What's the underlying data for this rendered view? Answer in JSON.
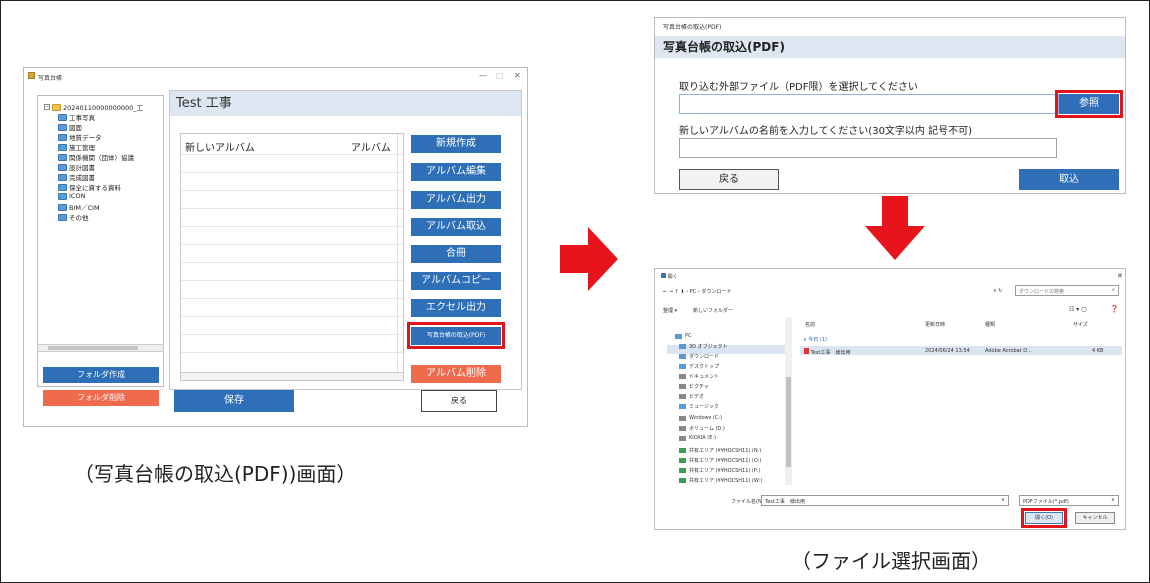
{
  "left_window": {
    "title": "写真台帳",
    "tree": [
      "20240110000000000_工",
      "工事写真",
      "図面",
      "地質データ",
      "施工管理",
      "関係機関（団体）協議",
      "設計図書",
      "完成図書",
      "保全に資する資料",
      "ICON",
      "BIM／CIM",
      "その他"
    ],
    "project_title": "Test 工事",
    "list_headers": {
      "name": "新しいアルバム",
      "album": "アルバム"
    },
    "buttons": {
      "new": "新規作成",
      "edit": "アルバム編集",
      "export": "アルバム出力",
      "import": "アルバム取込",
      "merge": "合冊",
      "copy": "アルバムコピー",
      "excel": "エクセル出力",
      "import_pdf": "写真台帳の取込(PDF)",
      "delete_album": "アルバム削除",
      "save": "保存",
      "back": "戻る",
      "create_folder": "フォルダ作成",
      "delete_folder": "フォルダ削除"
    },
    "caption": "（写真台帳の取込(PDF))画面）"
  },
  "import_dialog": {
    "titlebar": "写真台帳の取込(PDF)",
    "header": "写真台帳の取込(PDF)",
    "file_label": "取り込む外部ファイル（PDF限）を選択してください",
    "file_value": "",
    "browse": "参照",
    "name_label": "新しいアルバムの名前を入力してください(30文字以内 記号不可)",
    "name_value": "",
    "back": "戻る",
    "import": "取込"
  },
  "file_dialog": {
    "title": "開く",
    "path": "← → ↑ ⬇ › PC › ダウンロード",
    "search_placeholder": "ダウンロードの検索",
    "organize": "整理 ▾",
    "new_folder": "新しいフォルダー",
    "nav": [
      "PC",
      "3D オブジェクト",
      "ダウンロード",
      "デスクトップ",
      "ドキュメント",
      "ピクチャ",
      "ビデオ",
      "ミュージック",
      "Windows (C:)",
      "ボリューム (D:)",
      "KIOXIA (E:)",
      "共有エリア (¥¥HOCSH11) (N:)",
      "共有エリア (¥¥HOCSH11) (O:)",
      "共有エリア (¥¥HOCSH11) (P:)",
      "共有エリア (¥¥HOCSH11) (W:)"
    ],
    "columns": [
      "名前",
      "更新日時",
      "種類",
      "サイズ"
    ],
    "group": "∨ 今日 (1)",
    "file": {
      "name": "Test工事　様出用",
      "date": "2024/06/24 13:54",
      "type": "Adobe Acrobat D...",
      "size": "4 KB"
    },
    "filename_label": "ファイル名(N):",
    "filename_value": "Test工事　様出用",
    "filetype": "PDFファイル(*.pdf)",
    "open": "開く(O)",
    "cancel": "キャンセル",
    "caption": "（ファイル選択画面）"
  },
  "colors": {
    "accent_blue": "#2e6fb8",
    "danger_orange": "#f06a4e",
    "highlight_red": "#e2141c",
    "header_bg": "#dde6f1"
  }
}
